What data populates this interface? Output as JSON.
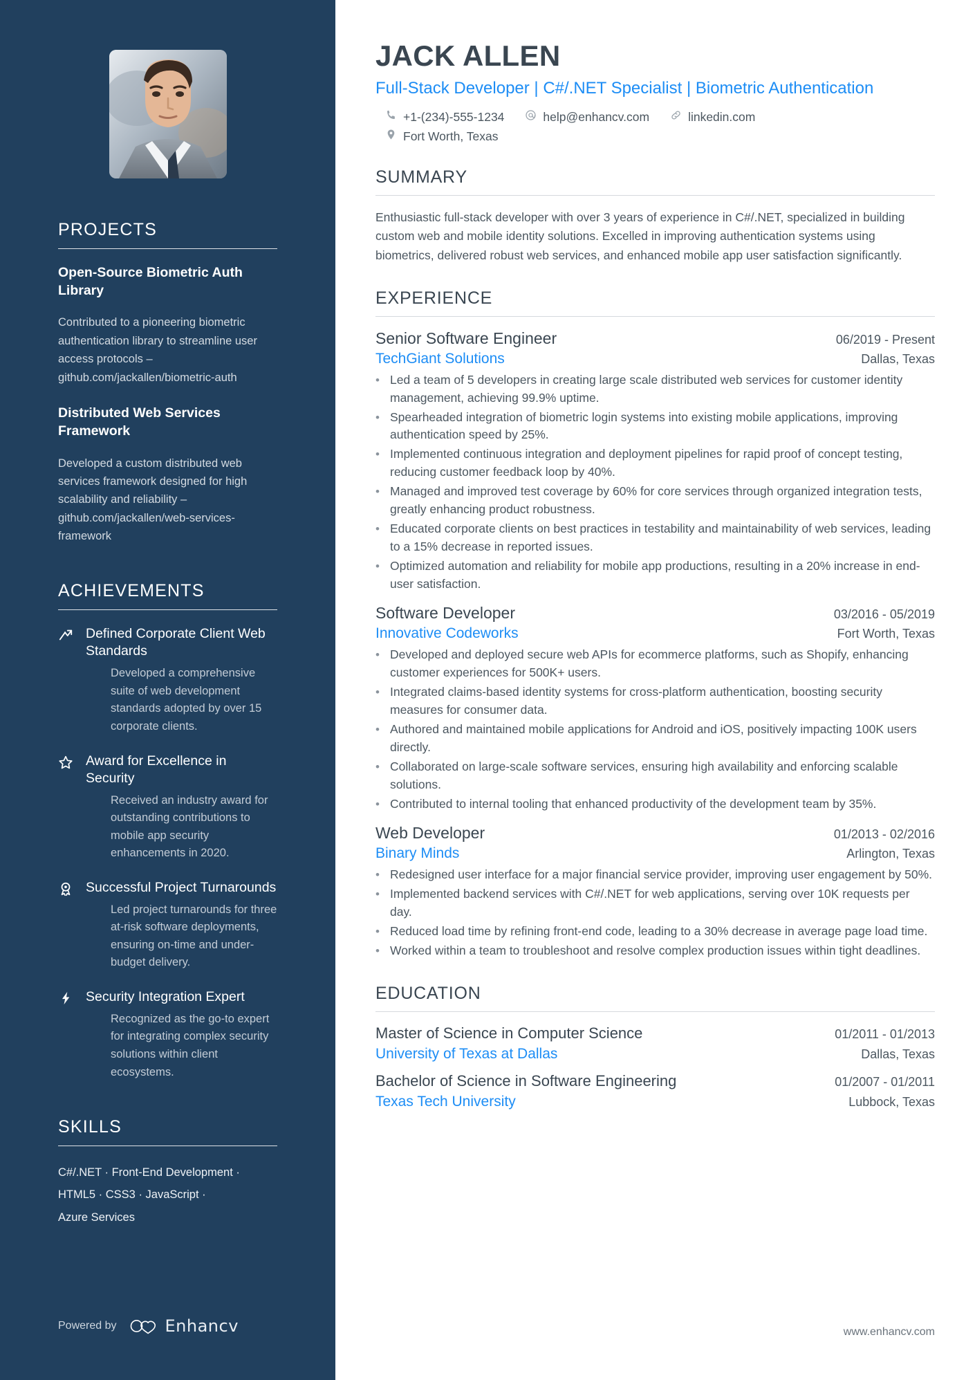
{
  "colors": {
    "sidebar_bg": "#21405e",
    "accent": "#1d8df5",
    "heading": "#3a4651",
    "body": "#4c5760"
  },
  "header": {
    "name": "JACK ALLEN",
    "headline": "Full-Stack Developer | C#/.NET Specialist | Biometric Authentication",
    "contacts": [
      {
        "icon": "phone-icon",
        "text": "+1-(234)-555-1234"
      },
      {
        "icon": "email-icon",
        "text": "help@enhancv.com"
      },
      {
        "icon": "link-icon",
        "text": "linkedin.com"
      },
      {
        "icon": "location-icon",
        "text": "Fort Worth, Texas"
      }
    ]
  },
  "sidebar": {
    "photo_alt": "profile-photo",
    "projects": {
      "heading": "PROJECTS",
      "items": [
        {
          "title": "Open-Source Biometric Auth Library",
          "description": "Contributed to a pioneering biometric authentication library to streamline user access protocols – github.com/jackallen/biometric-auth"
        },
        {
          "title": "Distributed Web Services Framework",
          "description": "Developed a custom distributed web services framework designed for high scalability and reliability – github.com/jackallen/web-services-framework"
        }
      ]
    },
    "achievements": {
      "heading": "ACHIEVEMENTS",
      "items": [
        {
          "icon": "trending-up-icon",
          "title": "Defined Corporate Client Web Standards",
          "description": "Developed a comprehensive suite of web development standards adopted by over 15 corporate clients."
        },
        {
          "icon": "star-icon",
          "title": "Award for Excellence in Security",
          "description": "Received an industry award for outstanding contributions to mobile app security enhancements in 2020."
        },
        {
          "icon": "award-ribbon-icon",
          "title": "Successful Project Turnarounds",
          "description": "Led project turnarounds for three at-risk software deployments, ensuring on-time and under-budget delivery."
        },
        {
          "icon": "lightning-bolt-icon",
          "title": "Security Integration Expert",
          "description": "Recognized as the go-to expert for integrating complex security solutions within client ecosystems."
        }
      ]
    },
    "skills": {
      "heading": "SKILLS",
      "lines": [
        "C#/.NET · Front-End Development ·",
        "HTML5 · CSS3 · JavaScript ·",
        "Azure Services"
      ]
    },
    "powered_by": {
      "label": "Powered by",
      "brand": "Enhancv"
    }
  },
  "main": {
    "summary": {
      "heading": "SUMMARY",
      "text": "Enthusiastic full-stack developer with over 3 years of experience in C#/.NET, specialized in building custom web and mobile identity solutions. Excelled in improving authentication systems using biometrics, delivered robust web services, and enhanced mobile app user satisfaction significantly."
    },
    "experience": {
      "heading": "EXPERIENCE",
      "jobs": [
        {
          "title": "Senior Software Engineer",
          "dates": "06/2019 - Present",
          "org": "TechGiant Solutions",
          "location": "Dallas, Texas",
          "bullets": [
            "Led a team of 5 developers in creating large scale distributed web services for customer identity management, achieving 99.9% uptime.",
            "Spearheaded integration of biometric login systems into existing mobile applications, improving authentication speed by 25%.",
            "Implemented continuous integration and deployment pipelines for rapid proof of concept testing, reducing customer feedback loop by 40%.",
            "Managed and improved test coverage by 60% for core services through organized integration tests, greatly enhancing product robustness.",
            "Educated corporate clients on best practices in testability and maintainability of web services, leading to a 15% decrease in reported issues.",
            "Optimized automation and reliability for mobile app productions, resulting in a 20% increase in end-user satisfaction."
          ]
        },
        {
          "title": "Software Developer",
          "dates": "03/2016 - 05/2019",
          "org": "Innovative Codeworks",
          "location": "Fort Worth, Texas",
          "bullets": [
            "Developed and deployed secure web APIs for ecommerce platforms, such as Shopify, enhancing customer experiences for 500K+ users.",
            "Integrated claims-based identity systems for cross-platform authentication, boosting security measures for consumer data.",
            "Authored and maintained mobile applications for Android and iOS, positively impacting 100K users directly.",
            "Collaborated on large-scale software services, ensuring high availability and enforcing scalable solutions.",
            "Contributed to internal tooling that enhanced productivity of the development team by 35%."
          ]
        },
        {
          "title": "Web Developer",
          "dates": "01/2013 - 02/2016",
          "org": "Binary Minds",
          "location": "Arlington, Texas",
          "bullets": [
            "Redesigned user interface for a major financial service provider, improving user engagement by 50%.",
            "Implemented backend services with C#/.NET for web applications, serving over 10K requests per day.",
            "Reduced load time by refining front-end code, leading to a 30% decrease in average page load time.",
            "Worked within a team to troubleshoot and resolve complex production issues within tight deadlines."
          ]
        }
      ]
    },
    "education": {
      "heading": "EDUCATION",
      "items": [
        {
          "degree": "Master of Science in Computer Science",
          "dates": "01/2011 - 01/2013",
          "school": "University of Texas at Dallas",
          "location": "Dallas, Texas"
        },
        {
          "degree": "Bachelor of Science in Software Engineering",
          "dates": "01/2007 - 01/2011",
          "school": "Texas Tech University",
          "location": "Lubbock, Texas"
        }
      ]
    },
    "website": "www.enhancv.com"
  }
}
